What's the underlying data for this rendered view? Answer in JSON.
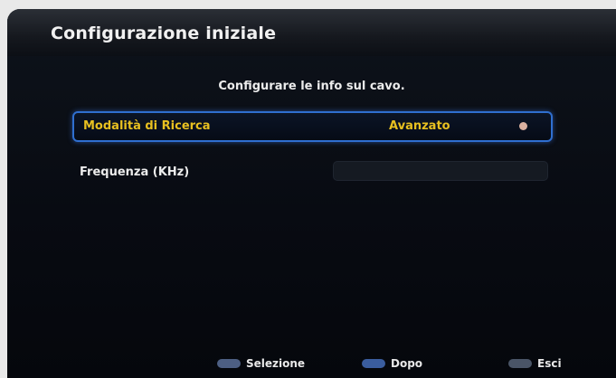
{
  "header": {
    "title": "Configurazione iniziale"
  },
  "main": {
    "subtitle": "Configurare le info sul cavo.",
    "search_mode": {
      "label": "Modalità di Ricerca",
      "value": "Avanzato",
      "icon": "arrow-icon"
    },
    "frequency": {
      "label": "Frequenza (KHz)",
      "value": ""
    }
  },
  "footer": {
    "select_label": "Selezione",
    "next_label": "Dopo",
    "exit_label": "Esci"
  },
  "colors": {
    "highlight_border": "#2f6fd0",
    "accent_text": "#e8c020"
  }
}
